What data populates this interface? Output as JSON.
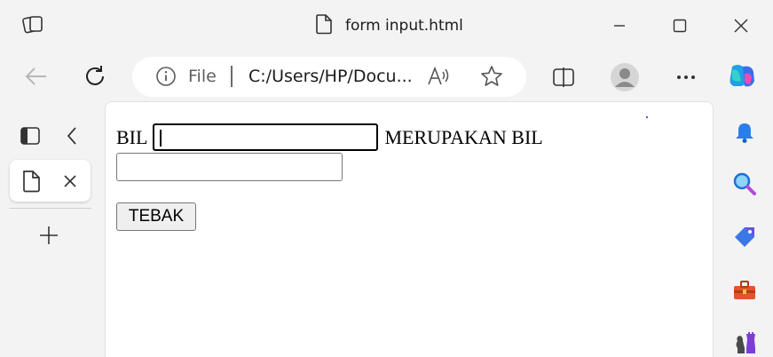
{
  "window": {
    "title": "form input.html"
  },
  "toolbar": {
    "address_scheme": "File",
    "address_url": "C:/Users/HP/Docu..."
  },
  "page": {
    "label_bil": "BIL",
    "label_merupakan": "MERUPAKAN BIL",
    "input_number_value": "",
    "input_result_value": "",
    "button_tebak": "TEBAK"
  },
  "icons": {
    "tab_actions": "tab-actions-icon",
    "back": "back-arrow-icon",
    "refresh": "refresh-icon",
    "info": "info-icon",
    "read_aloud": "read-aloud-icon",
    "favorite": "star-icon",
    "split_screen": "split-screen-icon",
    "profile": "profile-avatar-icon",
    "more": "more-dots-icon",
    "copilot": "copilot-icon",
    "vertical_tabs": "vertical-tabs-icon",
    "collapse": "collapse-chevron-icon",
    "new_tab": "plus-icon",
    "close_tab": "close-icon",
    "page_tab": "page-icon",
    "bell": "bell-icon",
    "search": "search-icon",
    "tag": "tag-icon",
    "toolbox": "toolbox-icon",
    "chess": "chess-icon"
  }
}
